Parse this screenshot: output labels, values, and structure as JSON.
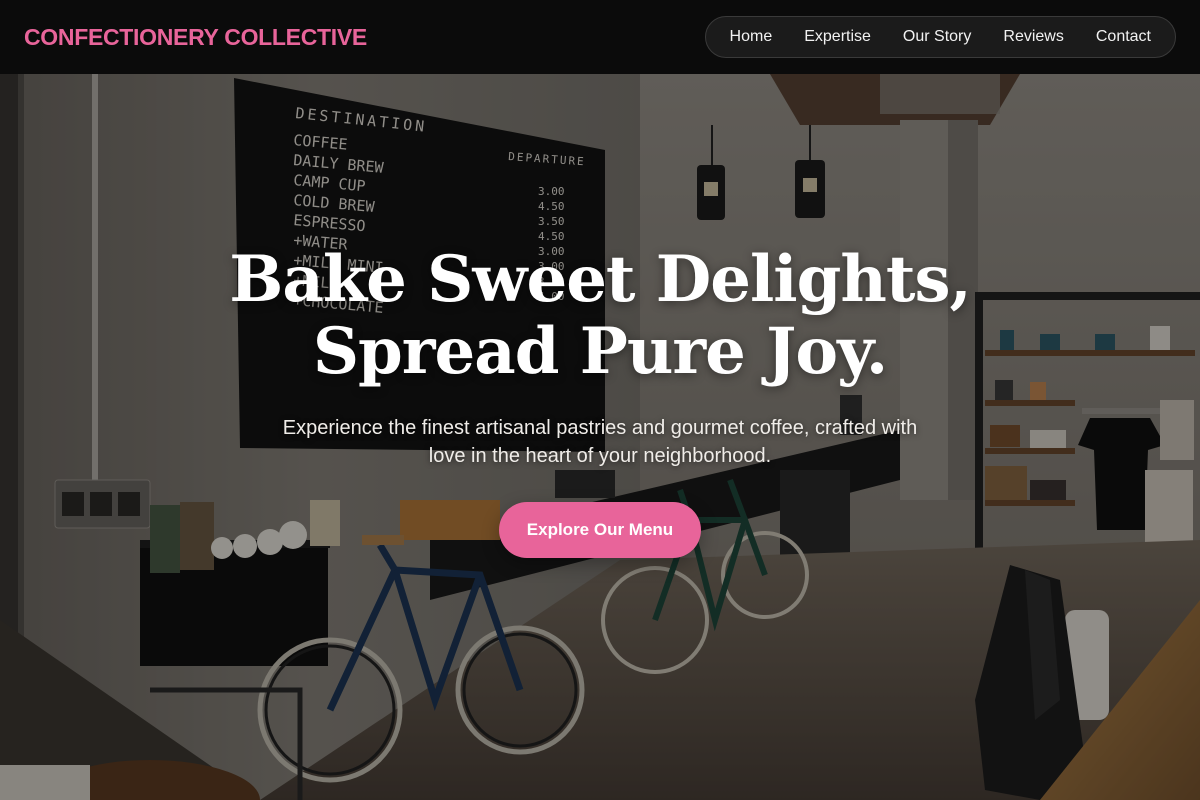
{
  "brand": {
    "name": "CONFECTIONERY COLLECTIVE"
  },
  "nav": {
    "items": [
      {
        "label": "Home"
      },
      {
        "label": "Expertise"
      },
      {
        "label": "Our Story"
      },
      {
        "label": "Reviews"
      },
      {
        "label": "Contact"
      }
    ]
  },
  "hero": {
    "title_line1": "Bake Sweet Delights,",
    "title_line2": "Spread Pure Joy.",
    "subtitle": "Experience the finest artisanal pastries and gourmet coffee, crafted with love in the heart of your neighborhood.",
    "cta_label": "Explore Our Menu"
  },
  "menu_board": {
    "heading_left": "DESTINATION",
    "heading_right": "DEPARTURE",
    "items": [
      "COFFEE",
      "DAILY BREW",
      "CAMP CUP",
      "COLD BREW",
      "ESPRESSO",
      "+WATER",
      "+MILK MINI",
      "+MILK",
      "+CHOCOLATE"
    ],
    "prices": [
      "3.00",
      "4.50",
      "3.50",
      "4.50",
      "3.00",
      "3.00",
      "3.50",
      "4.00"
    ]
  },
  "colors": {
    "accent": "#e8649a",
    "header_bg": "#0a0a0a",
    "text": "#ffffff"
  }
}
